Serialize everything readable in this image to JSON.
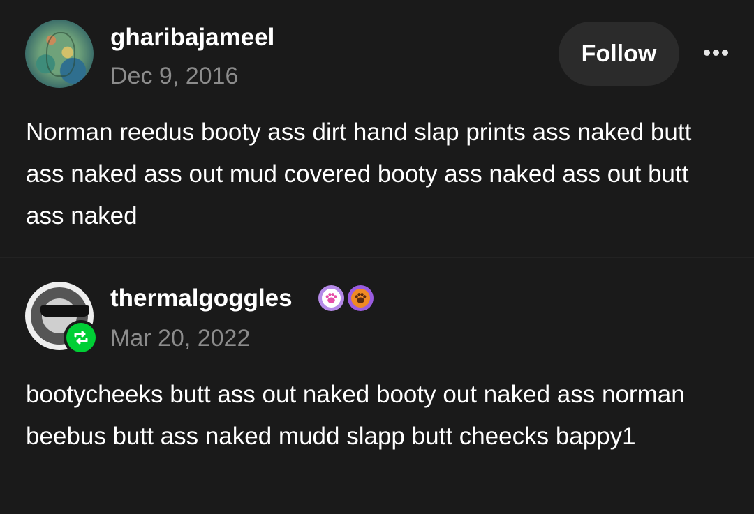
{
  "posts": [
    {
      "username": "gharibajameel",
      "date": "Dec 9, 2016",
      "follow_label": "Follow",
      "more_icon": "ellipsis-icon",
      "body": "Norman reedus booty ass dirt hand slap prints ass naked butt ass naked ass out mud covered booty ass naked ass out butt ass naked"
    },
    {
      "username": "thermalgoggles",
      "date": "Mar 20, 2022",
      "badges": [
        "paw-badge-icon",
        "paw-badge-icon"
      ],
      "reblog_icon": "reblog-icon",
      "body": "bootycheeks butt ass out naked booty out naked ass norman beebus butt ass naked mudd slapp butt cheecks bappy1"
    }
  ],
  "colors": {
    "background": "#1a1a1a",
    "text": "#ffffff",
    "muted": "#8c8c8c",
    "button": "#2b2b2b",
    "reblog_green": "#00cf35"
  }
}
